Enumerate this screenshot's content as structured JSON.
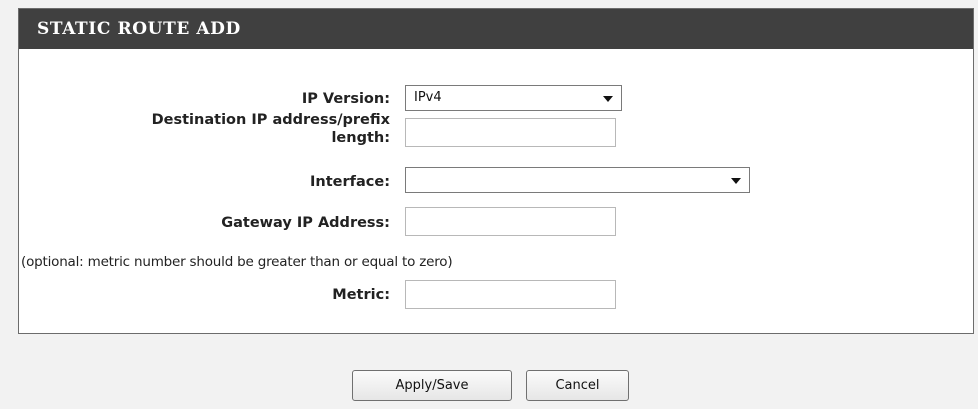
{
  "section": {
    "title": "STATIC ROUTE ADD"
  },
  "form": {
    "ip_version": {
      "label": "IP Version:",
      "value": "IPv4"
    },
    "destination": {
      "label_line1": "Destination IP address/prefix",
      "label_line2": "length:",
      "value": ""
    },
    "interface": {
      "label": "Interface:",
      "value": ""
    },
    "gateway": {
      "label": "Gateway IP Address:",
      "value": ""
    },
    "metric_note": "(optional: metric number should be greater than or equal to zero)",
    "metric": {
      "label": "Metric:",
      "value": ""
    }
  },
  "buttons": {
    "apply_label": "Apply/Save",
    "cancel_label": "Cancel"
  }
}
